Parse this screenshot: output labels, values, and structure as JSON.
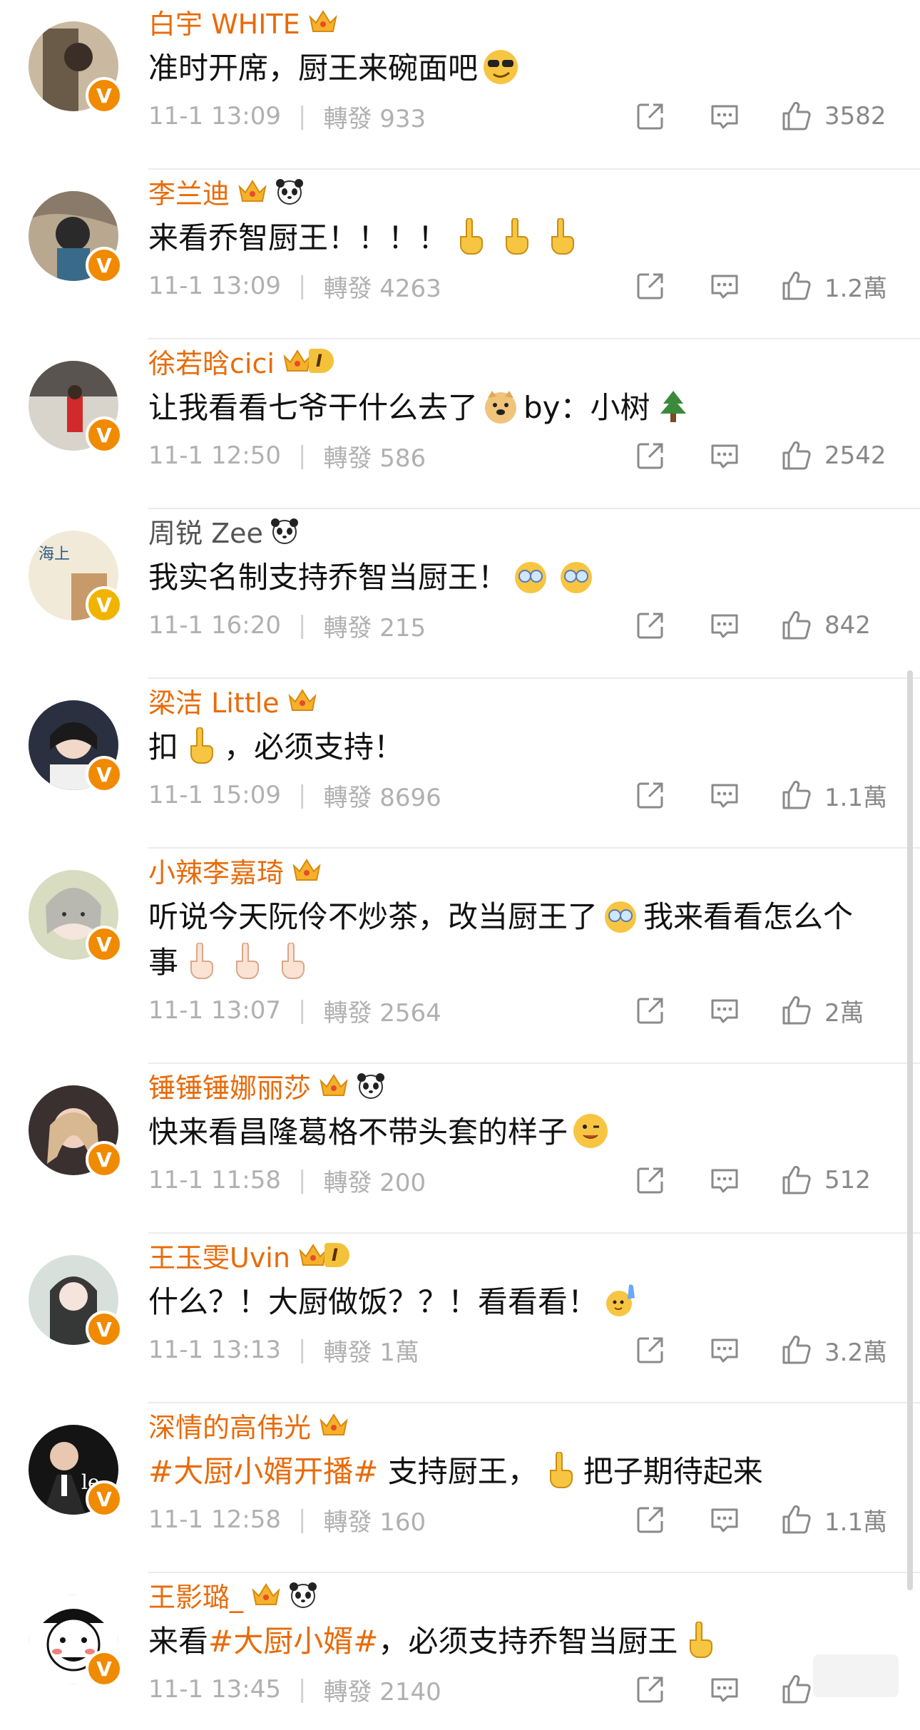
{
  "forward_label": "轉發",
  "comments": [
    {
      "name": "白宇 WHITE",
      "text": "准时开席，厨王来碗面吧",
      "time": "11-1 13:09",
      "forwards": "933",
      "likes": "3582"
    },
    {
      "name": "李兰迪",
      "text": "来看乔智厨王！！！！",
      "time": "11-1 13:09",
      "forwards": "4263",
      "likes": "1.2萬"
    },
    {
      "name": "徐若晗cici",
      "level": "I",
      "text": "让我看看七爷干什么去了",
      "text2": "by：小树",
      "time": "11-1 12:50",
      "forwards": "586",
      "likes": "2542"
    },
    {
      "name": "周锐 Zee",
      "text": "我实名制支持乔智当厨王！",
      "time": "11-1 16:20",
      "forwards": "215",
      "likes": "842"
    },
    {
      "name": "梁洁 Little",
      "text_a": "扣",
      "text_b": "，必须支持！",
      "time": "11-1 15:09",
      "forwards": "8696",
      "likes": "1.1萬"
    },
    {
      "name": "小辣李嘉琦",
      "text": "听说今天阮伶不炒茶，改当厨王了",
      "text2": "我来看看怎么个事",
      "time": "11-1 13:07",
      "forwards": "2564",
      "likes": "2萬"
    },
    {
      "name": "锤锤锤娜丽莎",
      "text": "快来看昌隆葛格不带头套的样子",
      "time": "11-1 11:58",
      "forwards": "200",
      "likes": "512"
    },
    {
      "name": "王玉雯Uvin",
      "level": "I",
      "text": "什么？！大厨做饭？？！看看看！",
      "time": "11-1 13:13",
      "forwards": "1萬",
      "likes": "3.2萬"
    },
    {
      "name": "深情的高伟光",
      "tag": "#大厨小婿开播#",
      "text": " 支持厨王，",
      "text2": "把子期待起来",
      "time": "11-1 12:58",
      "forwards": "160",
      "likes": "1.1萬"
    },
    {
      "name": "王影璐_",
      "text_a": "来看",
      "tag": "#大厨小婿#",
      "text_b": "，必须支持乔智当厨王",
      "time": "11-1 13:45",
      "forwards": "2140",
      "likes": ""
    }
  ],
  "colors": {
    "name": "#e86b0a",
    "meta": "#b0b0b0",
    "badge": "#f08a00"
  }
}
